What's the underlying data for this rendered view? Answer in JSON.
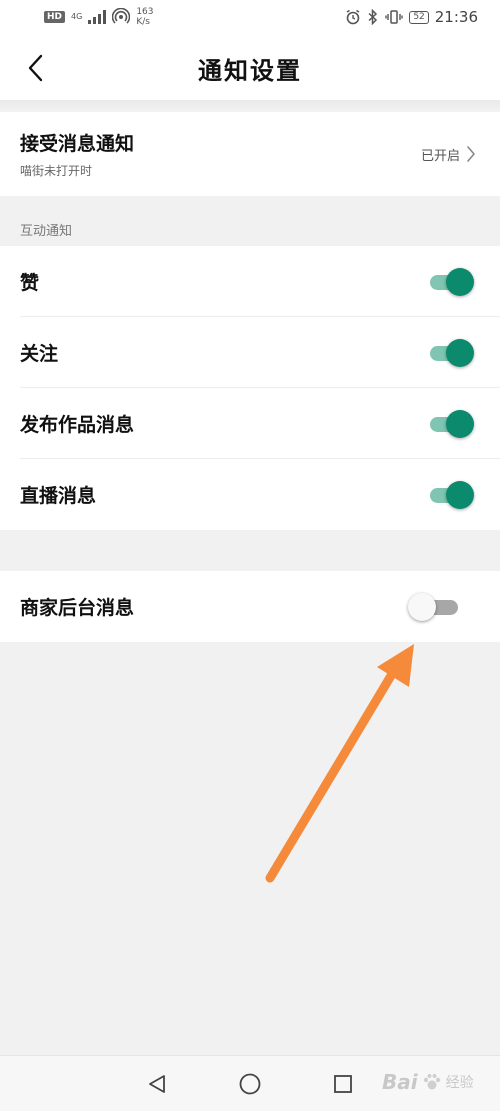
{
  "status_bar": {
    "hd": "HD",
    "net": "4G",
    "speed_value": "163",
    "speed_unit": "K/s",
    "battery": "52",
    "time": "21:36"
  },
  "header": {
    "title": "通知设置"
  },
  "receive": {
    "label": "接受消息通知",
    "sub": "喵街未打开时",
    "status": "已开启"
  },
  "section_interaction": {
    "label": "互动通知",
    "items": [
      {
        "label": "赞",
        "on": true
      },
      {
        "label": "关注",
        "on": true
      },
      {
        "label": "发布作品消息",
        "on": true
      },
      {
        "label": "直播消息",
        "on": true
      }
    ]
  },
  "merchant": {
    "label": "商家后台消息",
    "on": false
  },
  "watermark": {
    "brand": "Bai",
    "sub": "经验"
  },
  "colors": {
    "accent": "#0b8a6d",
    "accent_track": "#7fc5b2",
    "arrow": "#f58a3a",
    "background": "#f1f1f1"
  }
}
